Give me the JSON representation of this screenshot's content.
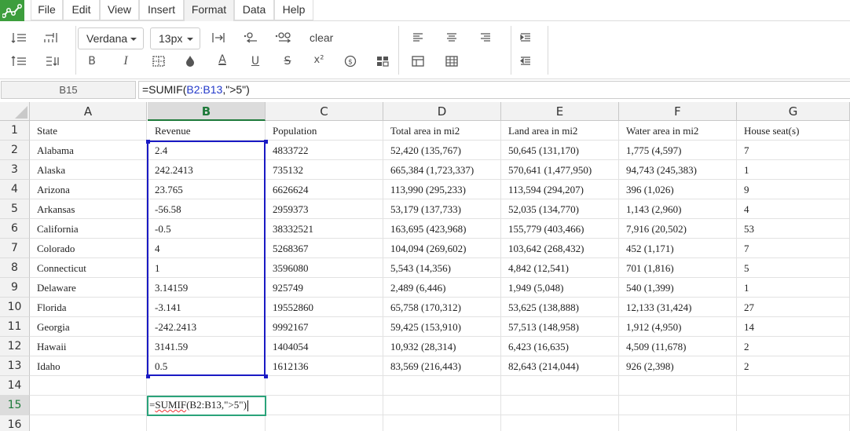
{
  "menu": {
    "items": [
      {
        "label": "File"
      },
      {
        "label": "Edit"
      },
      {
        "label": "View"
      },
      {
        "label": "Insert"
      },
      {
        "label": "Format",
        "active": true
      },
      {
        "label": "Data"
      },
      {
        "label": "Help"
      }
    ]
  },
  "toolbar": {
    "font_family": "Verdana",
    "font_size": "13px",
    "clear_label": "clear",
    "icons": [
      "insert-row-icon",
      "insert-column-icon",
      "delete-row-icon",
      "delete-column-icon",
      "text-direction-icon",
      "decrease-decimal-icon",
      "increase-decimal-icon",
      "bold-icon",
      "italic-icon",
      "border-icon",
      "fill-color-icon",
      "font-color-icon",
      "underline-icon",
      "strikethrough-icon",
      "superscript-icon",
      "currency-icon",
      "cell-format-icon",
      "align-left-icon",
      "align-center-icon",
      "align-right-icon",
      "table-icon",
      "grid-icon",
      "indent-icon",
      "outdent-icon"
    ],
    "bold_glyph": "B",
    "italic_glyph": "I",
    "font_color_glyph": "A",
    "underline_glyph": "U",
    "strike_glyph": "S",
    "superscript_glyph": "x²",
    "accent_color": "#3d9e3d"
  },
  "formula_bar": {
    "cell_ref": "B15",
    "prefix": "=SUMIF(",
    "range": "B2:B13",
    "suffix": ",\">5\")"
  },
  "columns": [
    "A",
    "B",
    "C",
    "D",
    "E",
    "F",
    "G"
  ],
  "selected_column": "B",
  "rows": [
    [
      "State",
      "Revenue",
      "Population",
      "Total area in mi2",
      "Land area in mi2",
      "Water area in mi2",
      "House seat(s)"
    ],
    [
      "Alabama",
      "2.4",
      "4833722",
      "52,420 (135,767)",
      "50,645 (131,170)",
      "1,775 (4,597)",
      "7"
    ],
    [
      "Alaska",
      "242.2413",
      "735132",
      "665,384 (1,723,337)",
      "570,641 (1,477,950)",
      "94,743 (245,383)",
      "1"
    ],
    [
      "Arizona",
      "23.765",
      "6626624",
      "113,990 (295,233)",
      "113,594 (294,207)",
      "396 (1,026)",
      "9"
    ],
    [
      "Arkansas",
      "-56.58",
      "2959373",
      "53,179 (137,733)",
      "52,035 (134,770)",
      "1,143 (2,960)",
      "4"
    ],
    [
      "California",
      "-0.5",
      "38332521",
      "163,695 (423,968)",
      "155,779 (403,466)",
      "7,916 (20,502)",
      "53"
    ],
    [
      "Colorado",
      "4",
      "5268367",
      "104,094 (269,602)",
      "103,642 (268,432)",
      "452 (1,171)",
      "7"
    ],
    [
      "Connecticut",
      "1",
      "3596080",
      "5,543 (14,356)",
      "4,842 (12,541)",
      "701 (1,816)",
      "5"
    ],
    [
      "Delaware",
      "3.14159",
      "925749",
      "2,489 (6,446)",
      "1,949 (5,048)",
      "540 (1,399)",
      "1"
    ],
    [
      "Florida",
      "-3.141",
      "19552860",
      "65,758 (170,312)",
      "53,625 (138,888)",
      "12,133 (31,424)",
      "27"
    ],
    [
      "Georgia",
      "-242.2413",
      "9992167",
      "59,425 (153,910)",
      "57,513 (148,958)",
      "1,912 (4,950)",
      "14"
    ],
    [
      "Hawaii",
      "3141.59",
      "1404054",
      "10,932 (28,314)",
      "6,423 (16,635)",
      "4,509 (11,678)",
      "2"
    ],
    [
      "Idaho",
      "0.5",
      "1612136",
      "83,569 (216,443)",
      "82,643 (214,044)",
      "926 (2,398)",
      "2"
    ],
    [
      "",
      "",
      "",
      "",
      "",
      "",
      ""
    ],
    [
      "",
      "",
      "",
      "",
      "",
      "",
      ""
    ],
    [
      "",
      "",
      "",
      "",
      "",
      "",
      ""
    ]
  ],
  "row_numbers": [
    "1",
    "2",
    "3",
    "4",
    "5",
    "6",
    "7",
    "8",
    "9",
    "10",
    "11",
    "12",
    "13",
    "14",
    "15",
    "16"
  ],
  "selected_row": "15",
  "editing_cell": {
    "prefix": "=",
    "squiggle": "SUMIF",
    "rest": "(B2:B13,\">5\")"
  }
}
